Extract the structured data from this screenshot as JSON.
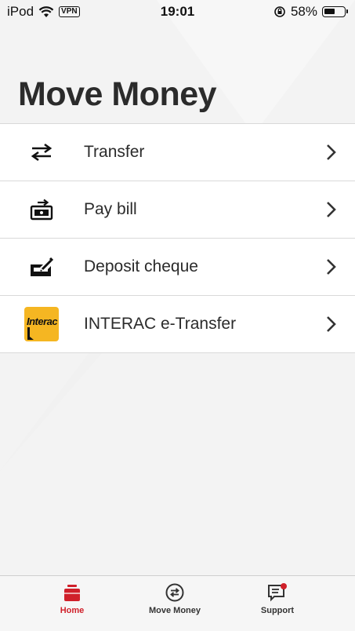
{
  "status_bar": {
    "device": "iPod",
    "vpn": "VPN",
    "time": "19:01",
    "battery": "58%",
    "battery_level": 0.58
  },
  "page": {
    "title": "Move Money"
  },
  "menu": {
    "items": [
      {
        "label": "Transfer",
        "icon": "transfer-arrows-icon"
      },
      {
        "label": "Pay bill",
        "icon": "pay-bill-icon"
      },
      {
        "label": "Deposit cheque",
        "icon": "deposit-cheque-icon"
      },
      {
        "label": "INTERAC e-Transfer",
        "icon": "interac-logo",
        "logo_text": "Interac"
      }
    ]
  },
  "tabbar": {
    "tabs": [
      {
        "label": "Home",
        "icon": "home-icon",
        "active": true
      },
      {
        "label": "Move Money",
        "icon": "move-money-icon",
        "active": false
      },
      {
        "label": "Support",
        "icon": "support-chat-icon",
        "active": false
      }
    ]
  },
  "colors": {
    "accent": "#d0202a",
    "interac_yellow": "#f5b622",
    "background": "#f3f3f3"
  }
}
